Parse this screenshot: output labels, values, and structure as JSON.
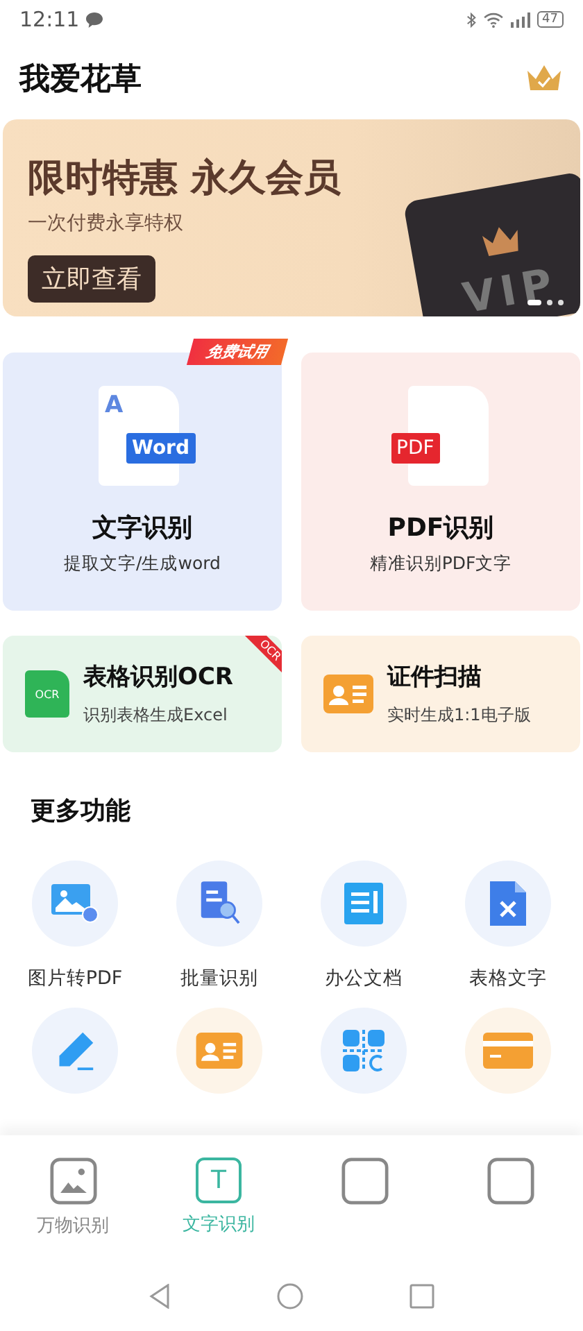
{
  "status_bar": {
    "time": "12:11",
    "battery": "47"
  },
  "header": {
    "title": "我爱花草"
  },
  "banner": {
    "title": "限时特惠 永久会员",
    "subtitle": "一次付费永享特权",
    "button": "立即查看",
    "card_text": "VIP",
    "dots": [
      {
        "selected": true
      },
      {
        "selected": false
      },
      {
        "selected": false
      }
    ]
  },
  "big_cards": [
    {
      "kind": "word",
      "title": "文字识别",
      "subtitle": "提取文字/生成word",
      "icon_letter": "A",
      "icon_text": "Word",
      "badge": "免费试用"
    },
    {
      "kind": "pdf",
      "title": "PDF识别",
      "subtitle": "精准识别PDF文字",
      "icon_text": "PDF"
    }
  ],
  "small_cards": [
    {
      "kind": "ocr",
      "title": "表格识别OCR",
      "subtitle": "识别表格生成Excel",
      "icon_text": "OCR",
      "corner": "OCR"
    },
    {
      "kind": "id",
      "title": "证件扫描",
      "subtitle": "实时生成1:1电子版"
    }
  ],
  "more": {
    "title": "更多功能",
    "items": [
      {
        "kind": "image",
        "label": "图片转PDF"
      },
      {
        "kind": "batch",
        "label": "批量识别"
      },
      {
        "kind": "doc",
        "label": "办公文档"
      },
      {
        "kind": "sheet",
        "label": "表格文字"
      },
      {
        "kind": "pen"
      },
      {
        "kind": "idcard"
      },
      {
        "kind": "qr"
      },
      {
        "kind": "bankcard"
      }
    ]
  },
  "bottom_nav": [
    {
      "kind": "image",
      "label": "万物识别",
      "selected": false
    },
    {
      "kind": "text",
      "icon_text": "T",
      "label": "文字识别",
      "selected": true
    },
    {
      "kind": "square",
      "selected": false
    },
    {
      "kind": "square",
      "selected": false
    }
  ]
}
